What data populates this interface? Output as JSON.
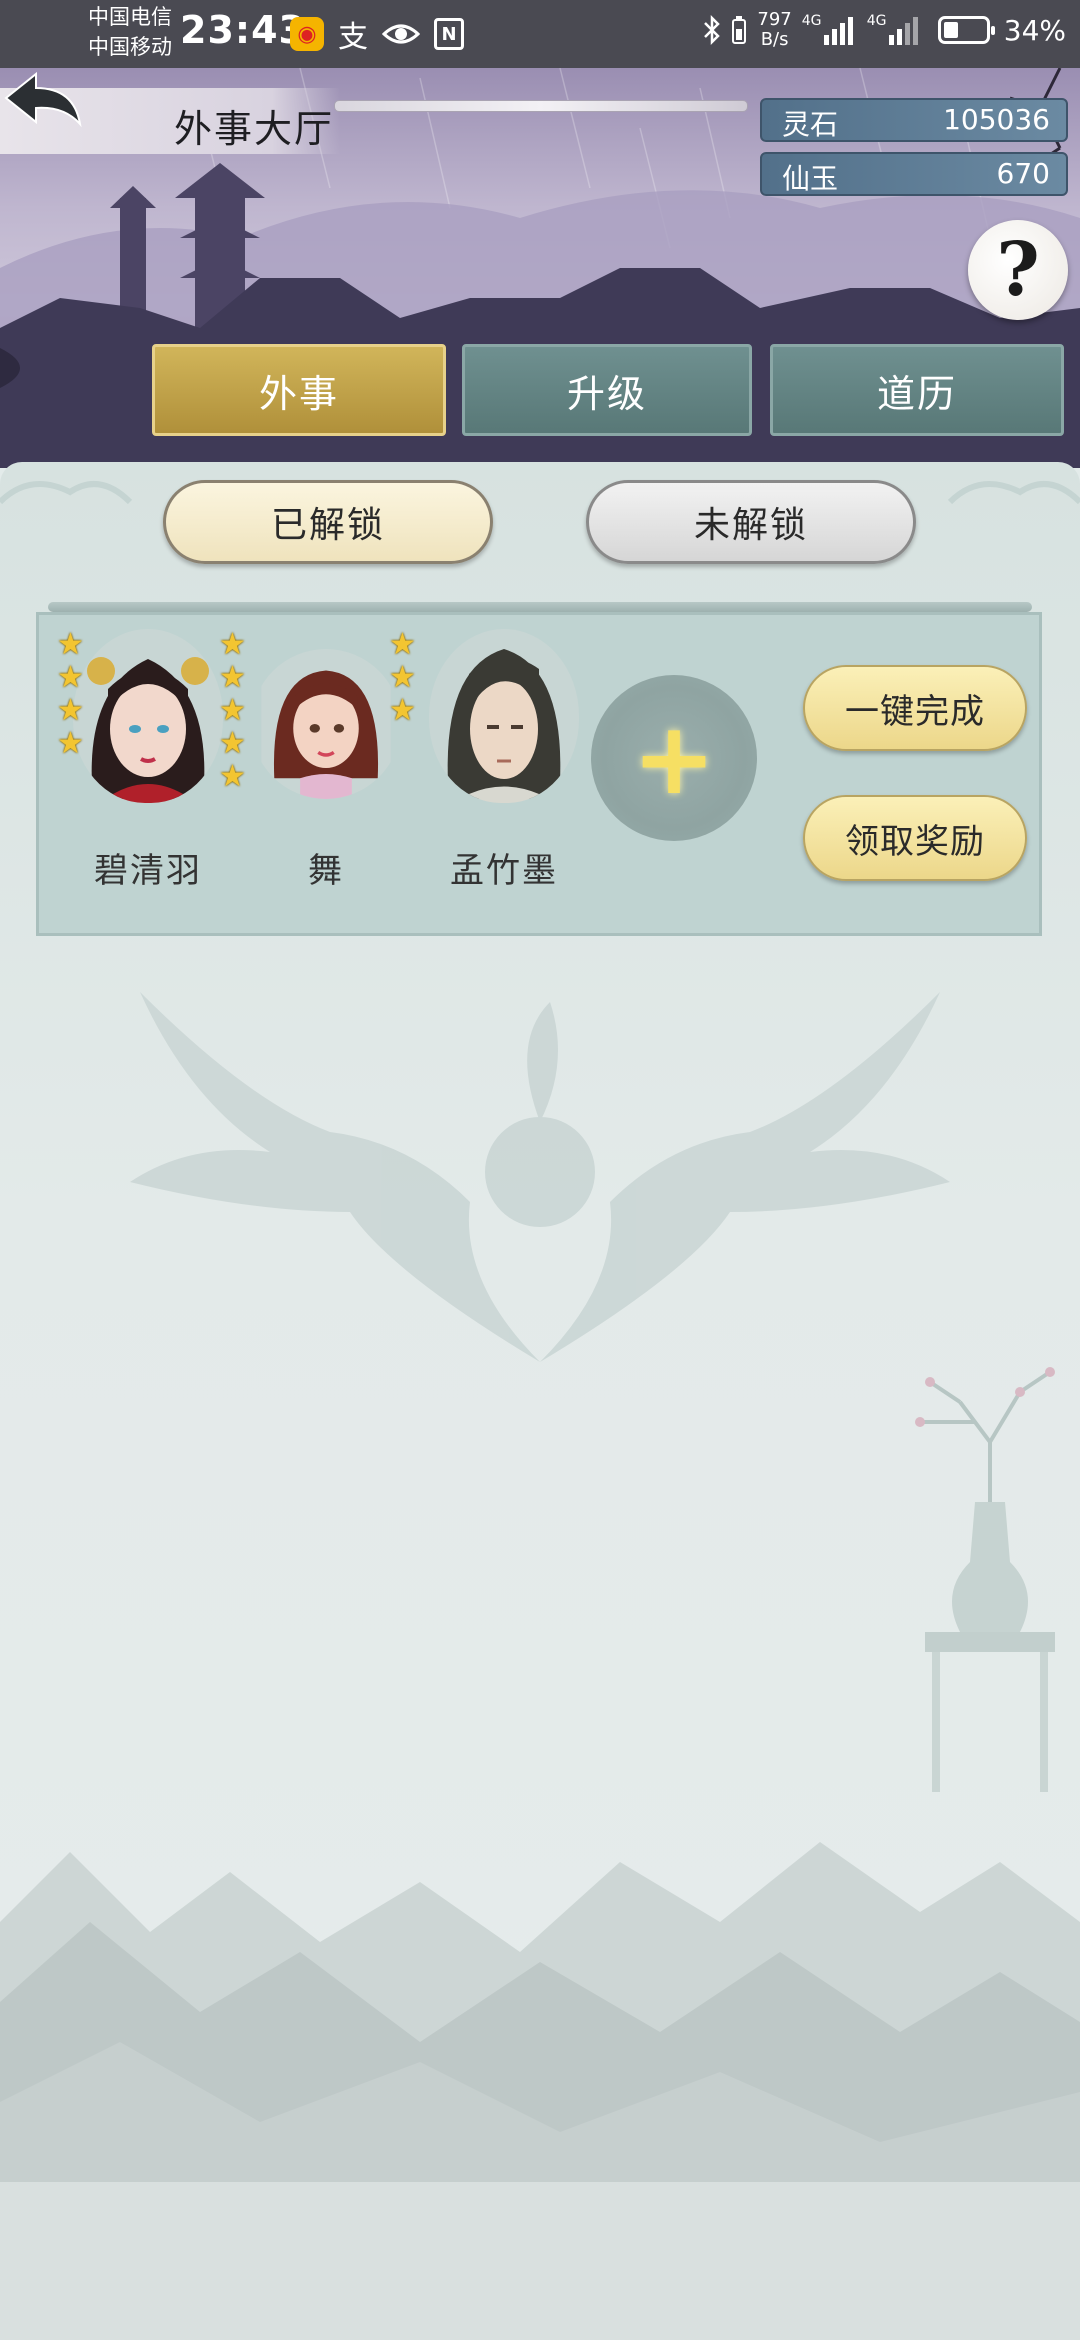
{
  "status_bar": {
    "carrier_1": "中国电信",
    "carrier_2": "中国移动",
    "time": "23:43",
    "net_speed_value": "797",
    "net_speed_unit": "B/s",
    "signal_1_label": "4G",
    "signal_2_label": "4G",
    "battery_text": "34%",
    "battery_level": 0.34,
    "nfc_label": "N",
    "app_label": "支"
  },
  "header": {
    "title": "外事大厅",
    "currencies": [
      {
        "name": "灵石",
        "value": "105036"
      },
      {
        "name": "仙玉",
        "value": "670"
      }
    ],
    "help_label": "?"
  },
  "tabs": [
    {
      "label": "外事",
      "active": true
    },
    {
      "label": "升级",
      "active": false
    },
    {
      "label": "道历",
      "active": false
    }
  ],
  "filters": {
    "unlocked": "已解锁",
    "locked": "未解锁"
  },
  "heroes": [
    {
      "name": "碧清羽",
      "stars": 9
    },
    {
      "name": "舞",
      "stars": 0
    },
    {
      "name": "孟竹墨",
      "stars": 3
    }
  ],
  "add_slot_icon": "+",
  "actions": {
    "complete_all": "一键完成",
    "claim_reward": "领取奖励"
  },
  "colors": {
    "active_tab": "#c4a64c",
    "inactive_tab": "#638483",
    "star": "#f3c531"
  }
}
